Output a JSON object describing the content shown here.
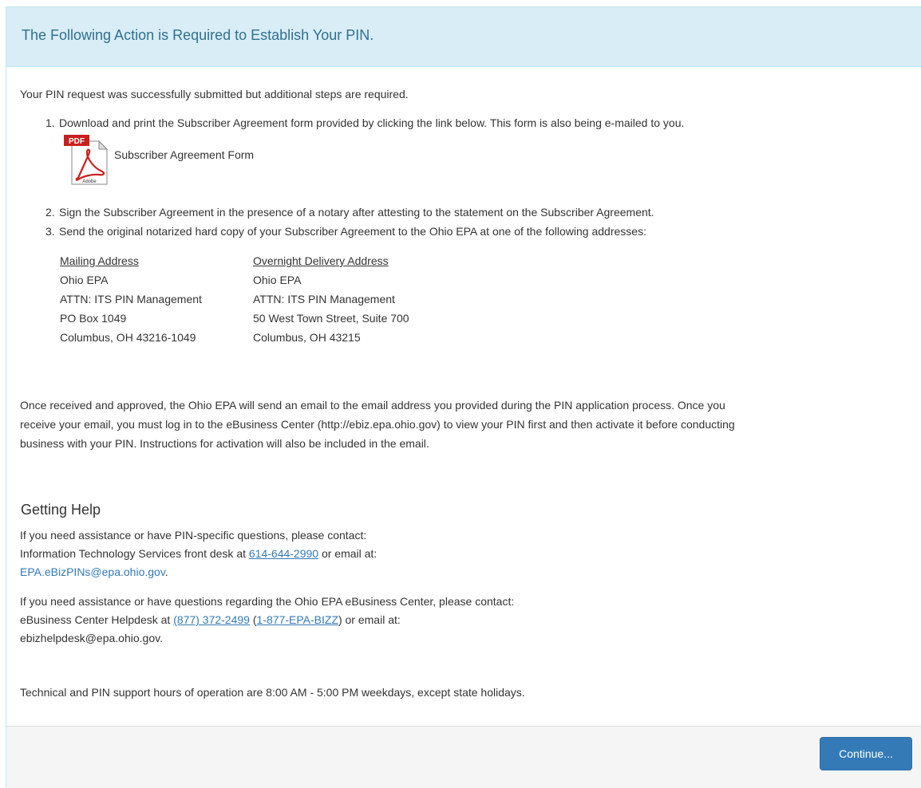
{
  "heading": "The Following Action is Required to Establish Your PIN.",
  "intro": "Your PIN request was successfully submitted but additional steps are required.",
  "steps": [
    {
      "num": "1.",
      "text": "Download and print the Subscriber Agreement form provided by clicking the link below. This form is also being e-mailed to you."
    },
    {
      "num": "2.",
      "text": "Sign the Subscriber Agreement in the presence of a notary after attesting to the statement on the Subscriber Agreement."
    },
    {
      "num": "3.",
      "text": "Send the original notarized hard copy of your Subscriber Agreement to the Ohio EPA at one of the following addresses:"
    }
  ],
  "pdf": {
    "badge": "PDF",
    "brand": "Adobe",
    "label": "Subscriber Agreement Form",
    "icon": "pdf-file-icon"
  },
  "mailing": {
    "title": "Mailing Address",
    "lines": [
      "Ohio EPA",
      "ATTN: ITS PIN Management",
      "PO Box 1049",
      "Columbus, OH  43216-1049"
    ]
  },
  "overnight": {
    "title": "Overnight Delivery Address",
    "lines": [
      "Ohio EPA",
      "ATTN: ITS PIN Management",
      "50 West Town Street, Suite 700",
      "Columbus, OH  43215"
    ]
  },
  "approval_lines": [
    "Once received and approved, the Ohio EPA will send an email to the email address you provided during the PIN application process. Once you",
    "receive your email, you must log in to the eBusiness Center (http://ebiz.epa.ohio.gov) to view your PIN first and then activate it before conducting",
    "business with your PIN. Instructions for activation will also be included in the email."
  ],
  "help": {
    "title": "Getting Help",
    "pin_line1": "If you need assistance or have PIN-specific questions, please contact:",
    "pin_line2_pre": "Information Technology Services front desk at ",
    "pin_phone": "614-644-2990",
    "pin_line2_post": " or email at:",
    "pin_email": "EPA.eBizPINs@epa.ohio.gov",
    "pin_email_post": ".",
    "ebiz_line1": "If you need assistance or have questions regarding the Ohio EPA eBusiness Center, please contact:",
    "ebiz_line2_pre": "eBusiness Center Helpdesk at ",
    "ebiz_phone": "(877) 372-2499",
    "ebiz_mid": " (",
    "ebiz_phone_alt": "1-877-EPA-BIZZ",
    "ebiz_line2_post": ") or email at:",
    "ebiz_email_line": "ebizhelpdesk@epa.ohio.gov."
  },
  "support_hours": "Technical and PIN support hours of operation are 8:00 AM - 5:00 PM weekdays, except state holidays.",
  "footer": {
    "continue_label": "Continue..."
  },
  "colors": {
    "heading_bg": "#d9edf7",
    "heading_text": "#31708f",
    "link": "#337ab7",
    "button": "#337ab7",
    "footer_bg": "#f5f5f5"
  }
}
